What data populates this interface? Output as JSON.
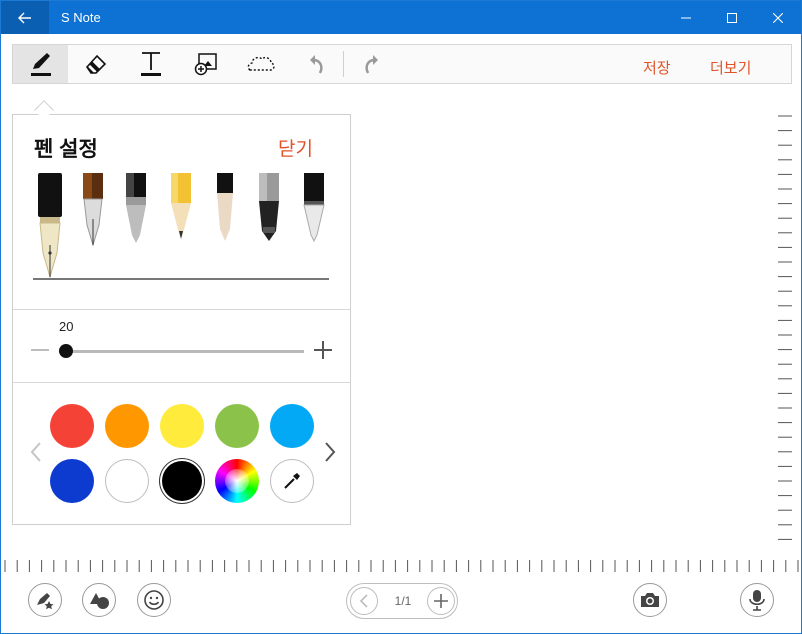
{
  "window": {
    "title": "S Note",
    "accent_color": "#0d72d3",
    "controls": [
      "minimize-icon",
      "maximize-icon",
      "close-icon"
    ]
  },
  "toolbar": {
    "tools": [
      {
        "name": "pen",
        "icon": "pen-icon",
        "active": true
      },
      {
        "name": "eraser",
        "icon": "eraser-icon",
        "active": false
      },
      {
        "name": "text",
        "icon": "text-icon",
        "active": false
      },
      {
        "name": "insert-image",
        "icon": "image-add-icon",
        "active": false
      },
      {
        "name": "selection",
        "icon": "lasso-select-icon",
        "active": false
      },
      {
        "name": "undo",
        "icon": "undo-icon",
        "active": false
      },
      {
        "name": "redo",
        "icon": "redo-icon",
        "active": false
      }
    ],
    "save_label": "저장",
    "more_label": "더보기",
    "link_color": "#e0522a"
  },
  "pen_panel": {
    "title": "펜 설정",
    "close_label": "닫기",
    "pens": [
      "fountain-pen",
      "calligraphy-pen",
      "brush-pen",
      "pencil",
      "marker",
      "felt-pen",
      "ballpoint-pen"
    ],
    "selected_pen": "fountain-pen",
    "size": {
      "value": "20",
      "level": 0.06
    },
    "colors": [
      {
        "hex": "#f44336",
        "name": "red"
      },
      {
        "hex": "#ff9800",
        "name": "orange"
      },
      {
        "hex": "#ffeb3b",
        "name": "yellow"
      },
      {
        "hex": "#8bc34a",
        "name": "green"
      },
      {
        "hex": "#03a9f4",
        "name": "sky-blue"
      },
      {
        "hex": "#0d3bd0",
        "name": "blue"
      },
      {
        "hex": "#ffffff",
        "name": "white"
      },
      {
        "hex": "#000000",
        "name": "black",
        "selected": true
      },
      {
        "hex": "spectrum",
        "name": "color-picker"
      },
      {
        "hex": "eyedropper",
        "name": "eyedropper"
      }
    ]
  },
  "bottom_bar": {
    "page_indicator": "1/1",
    "left_buttons": [
      "favorite-pen-icon",
      "shapes-icon",
      "emoji-icon"
    ],
    "right_buttons": [
      "camera-icon",
      "microphone-icon"
    ]
  }
}
